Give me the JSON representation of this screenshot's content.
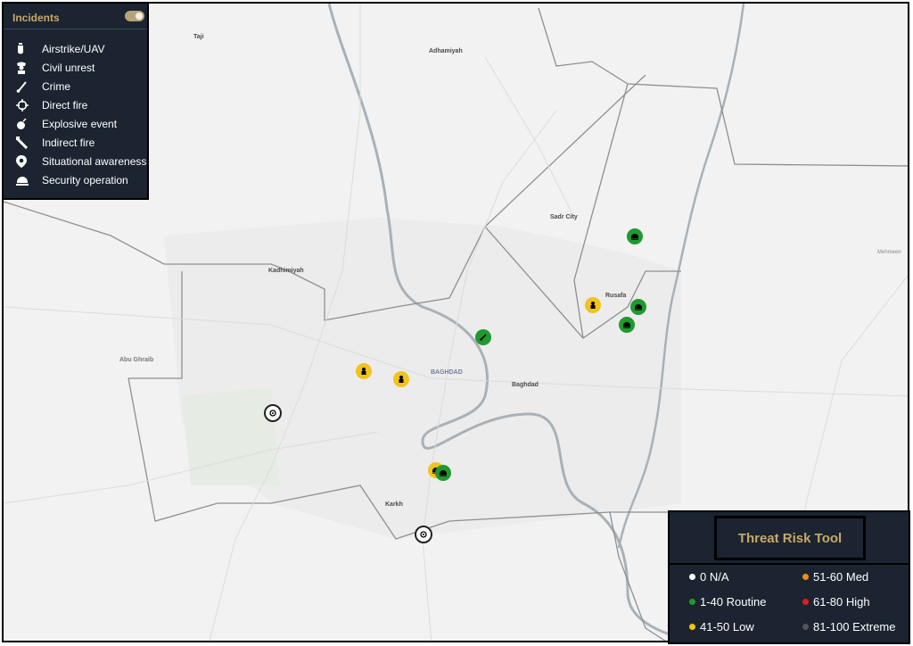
{
  "incidents_panel": {
    "title": "Incidents",
    "toggle_on": true,
    "items": [
      {
        "label": "Airstrike/UAV",
        "icon": "airstrike-icon"
      },
      {
        "label": "Civil unrest",
        "icon": "civil-unrest-icon"
      },
      {
        "label": "Crime",
        "icon": "crime-icon"
      },
      {
        "label": "Direct fire",
        "icon": "direct-fire-icon"
      },
      {
        "label": "Explosive event",
        "icon": "explosive-icon"
      },
      {
        "label": "Indirect fire",
        "icon": "indirect-fire-icon"
      },
      {
        "label": "Situational awareness",
        "icon": "situational-awareness-icon"
      },
      {
        "label": "Security operation",
        "icon": "security-operation-icon"
      }
    ]
  },
  "threat_panel": {
    "title": "Threat Risk Tool",
    "legend": [
      {
        "label": "0 N/A",
        "color": "#ffffff"
      },
      {
        "label": "1-40 Routine",
        "color": "#1f9a2e"
      },
      {
        "label": "41-50 Low",
        "color": "#f2c31b"
      },
      {
        "label": "51-60 Med",
        "color": "#f08c1c"
      },
      {
        "label": "61-80 High",
        "color": "#d92020"
      },
      {
        "label": "81-100 Extreme",
        "color": "#555555"
      }
    ]
  },
  "map": {
    "places": {
      "taji": "Taji",
      "adhamiyah": "Adhamiyah",
      "sadr_city": "Sadr City",
      "kadhimiyah": "Kadhimiyah",
      "rusafa": "Rusafa",
      "baghdad": "BAGHDAD",
      "baghdad_dist": "Baghdad",
      "abu_ghraib": "Abu Ghraib",
      "karkh": "Karkh",
      "mehmeen": "Mehmeen"
    }
  },
  "markers": [
    {
      "risk": "Routine",
      "type": "security-operation"
    },
    {
      "risk": "Low",
      "type": "civil-unrest"
    },
    {
      "risk": "Routine",
      "type": "security-operation"
    },
    {
      "risk": "Routine",
      "type": "security-operation"
    },
    {
      "risk": "Routine",
      "type": "crime"
    },
    {
      "risk": "Low",
      "type": "civil-unrest"
    },
    {
      "risk": "Low",
      "type": "civil-unrest"
    },
    {
      "risk": "N/A",
      "type": "situational-awareness"
    },
    {
      "risk": "Low",
      "type": "security-operation"
    },
    {
      "risk": "Routine",
      "type": "security-operation"
    },
    {
      "risk": "N/A",
      "type": "situational-awareness"
    }
  ]
}
